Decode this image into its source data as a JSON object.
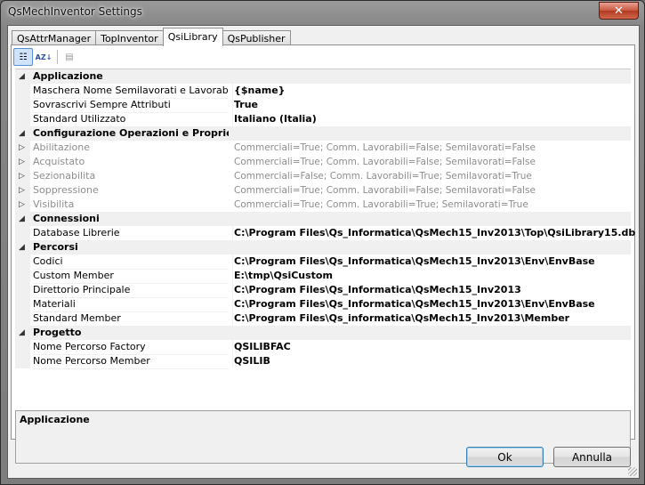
{
  "window": {
    "title": "QsMechInventor Settings",
    "close_glyph": "✕"
  },
  "tabs": [
    {
      "label": "QsAttrManager",
      "active": false
    },
    {
      "label": "TopInventor",
      "active": false
    },
    {
      "label": "QsiLibrary",
      "active": true
    },
    {
      "label": "QsPublisher",
      "active": false
    }
  ],
  "toolbar": {
    "categorized_icon": "categorized-icon",
    "alphabetical_icon": "alphabetical-sort-icon",
    "property_pages_icon": "property-pages-icon",
    "categorized_glyph": "☷",
    "alphabetical_glyph": "AZ↓",
    "property_pages_glyph": "▤"
  },
  "grid": {
    "rows": [
      {
        "type": "cat",
        "name": "Applicazione",
        "value": ""
      },
      {
        "type": "prop",
        "name": "Maschera Nome Semilavorati e Lavorabili",
        "value": "{$name}"
      },
      {
        "type": "prop",
        "name": "Sovrascrivi Sempre Attributi",
        "value": "True"
      },
      {
        "type": "prop",
        "name": "Standard Utilizzato",
        "value": "Italiano (Italia)"
      },
      {
        "type": "cat",
        "name": "Configurazione Operazioni e Proprietà",
        "value": ""
      },
      {
        "type": "dis",
        "name": "Abilitazione",
        "value": "Commerciali=True; Comm. Lavorabili=False; Semilavorati=False"
      },
      {
        "type": "dis",
        "name": "Acquistato",
        "value": "Commerciali=True; Comm. Lavorabili=False; Semilavorati=False"
      },
      {
        "type": "dis",
        "name": "Sezionabilita",
        "value": "Commerciali=False; Comm. Lavorabili=True; Semilavorati=True"
      },
      {
        "type": "dis",
        "name": "Soppressione",
        "value": "Commerciali=True; Comm. Lavorabili=False; Semilavorati=False"
      },
      {
        "type": "dis",
        "name": "Visibilita",
        "value": "Commerciali=True; Comm. Lavorabili=True; Semilavorati=True"
      },
      {
        "type": "cat",
        "name": "Connessioni",
        "value": ""
      },
      {
        "type": "prop",
        "name": "Database Librerie",
        "value": "C:\\Program Files\\Qs_Informatica\\QsMech15_Inv2013\\Top\\QsiLibrary15.db"
      },
      {
        "type": "cat",
        "name": "Percorsi",
        "value": ""
      },
      {
        "type": "prop",
        "name": "Codici",
        "value": "C:\\Program Files\\Qs_Informatica\\QsMech15_Inv2013\\Env\\EnvBase"
      },
      {
        "type": "prop",
        "name": "Custom Member",
        "value": "E:\\tmp\\QsiCustom"
      },
      {
        "type": "prop",
        "name": "Direttorio Principale",
        "value": "C:\\Program Files\\Qs_Informatica\\QsMech15_Inv2013"
      },
      {
        "type": "prop",
        "name": "Materiali",
        "value": "C:\\Program Files\\Qs_Informatica\\QsMech15_Inv2013\\Env\\EnvBase"
      },
      {
        "type": "prop",
        "name": "Standard Member",
        "value": "C:\\Program Files\\Qs_informatica\\QsMech15_Inv2013\\Member"
      },
      {
        "type": "cat",
        "name": "Progetto",
        "value": ""
      },
      {
        "type": "prop",
        "name": "Nome Percorso Factory",
        "value": "QSILIBFAC"
      },
      {
        "type": "prop",
        "name": "Nome Percorso Member",
        "value": "QSILIB"
      }
    ],
    "collapse_glyph": "◢",
    "expand_glyph": "▷"
  },
  "description": {
    "title": "Applicazione"
  },
  "buttons": {
    "ok": "Ok",
    "cancel": "Annulla"
  }
}
